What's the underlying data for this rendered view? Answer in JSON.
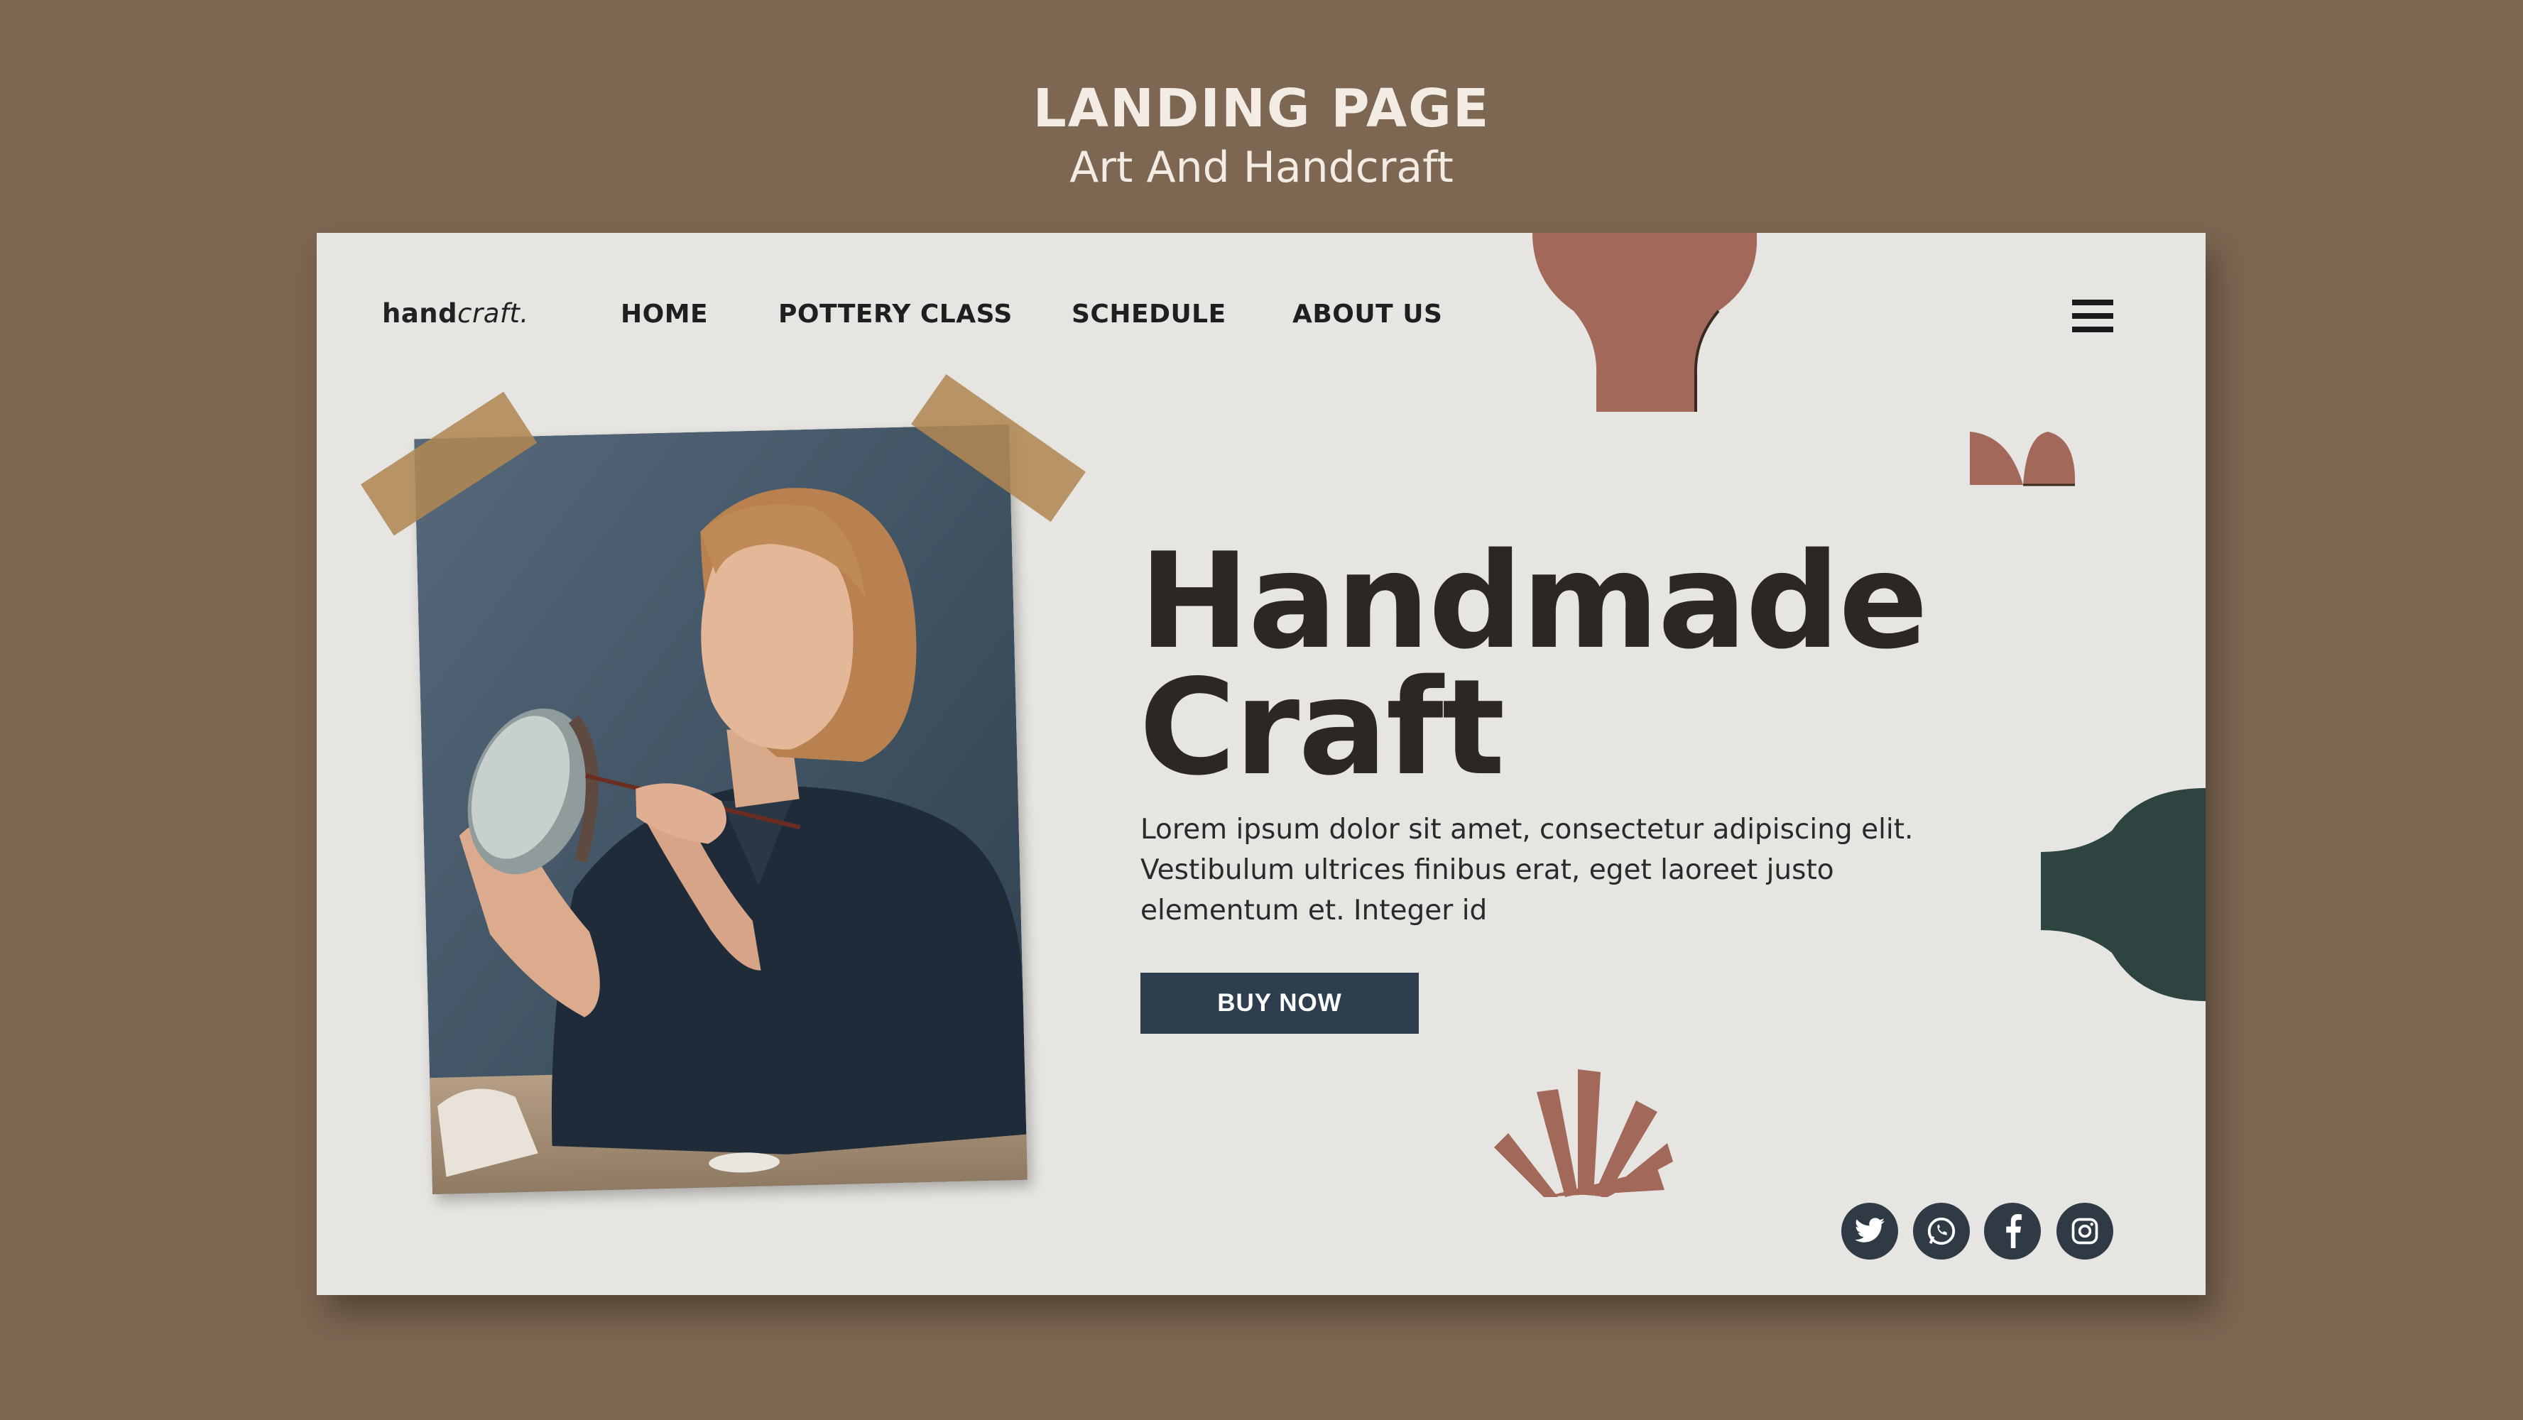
{
  "header": {
    "title": "LANDING PAGE",
    "subtitle": "Art And Handcraft"
  },
  "site": {
    "logo_bold": "hand",
    "logo_italic": "craft.",
    "nav": [
      "HOME",
      "POTTERY CLASS",
      "SCHEDULE",
      "ABOUT US"
    ]
  },
  "hero": {
    "headline_line1": "Handmade",
    "headline_line2": "Craft",
    "body": "Lorem ipsum dolor sit amet, consectetur adipiscing elit. Vestibulum ultrices finibus erat, eget laoreet justo elementum et. Integer id",
    "cta": "BUY NOW"
  },
  "social": [
    "twitter-icon",
    "whatsapp-icon",
    "facebook-icon",
    "instagram-icon"
  ],
  "colors": {
    "background": "#7d6753",
    "card": "#e7e5e1",
    "terracotta": "#a2695a",
    "dark_green": "#2d4440",
    "button": "#2f3e4e",
    "tape": "#b08853"
  }
}
